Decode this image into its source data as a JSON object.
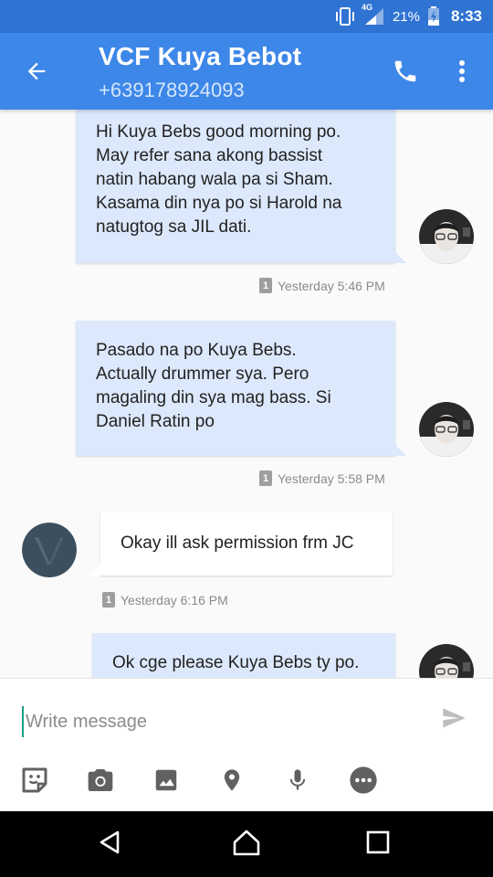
{
  "status_bar": {
    "network": "4G",
    "battery": "21%",
    "time": "8:33"
  },
  "app_bar": {
    "contact_name": "VCF Kuya Bebot",
    "phone_number": "+639178924093",
    "icons": [
      "back-arrow-icon",
      "phone-icon",
      "more-vert-icon"
    ]
  },
  "messages": [
    {
      "direction": "outgoing",
      "text": "Hi Kuya Bebs good morning po.\nMay refer sana akong bassist\nnatin habang wala pa si Sham.\nKasama din nya po si Harold na\nnatugtog sa JIL dati.",
      "sim": "1",
      "timestamp": "Yesterday 5:46 PM"
    },
    {
      "direction": "outgoing",
      "text": "Pasado na po Kuya Bebs.\nActually drummer sya. Pero\nmagaling din sya mag bass. Si\nDaniel Ratin po",
      "sim": "1",
      "timestamp": "Yesterday 5:58 PM"
    },
    {
      "direction": "incoming",
      "text": "Okay ill ask permission frm JC",
      "sim": "1",
      "timestamp": "Yesterday 6:16 PM"
    },
    {
      "direction": "outgoing",
      "text": "Ok cge please Kuya Bebs ty po."
    }
  ],
  "composer": {
    "placeholder": "Write message",
    "value": "",
    "tools": [
      "sticker-icon",
      "camera-icon",
      "image-icon",
      "location-icon",
      "microphone-icon",
      "more-options-icon"
    ]
  },
  "colors": {
    "status_bar": "#2f73d3",
    "app_bar": "#3d87e8",
    "outgoing_bubble": "#dce8fb",
    "incoming_bubble": "#ffffff",
    "cursor": "#16a085"
  }
}
